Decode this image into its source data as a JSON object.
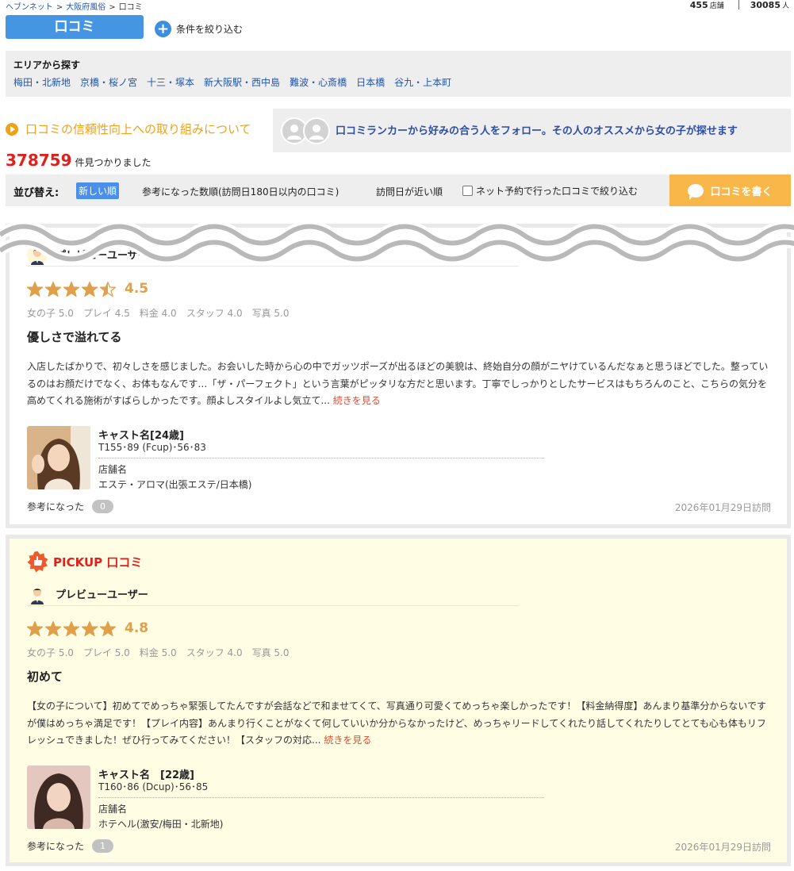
{
  "breadcrumb": [
    "ヘブンネット",
    "大阪府風俗",
    "口コミ"
  ],
  "breadcrumb_separator": ">",
  "stats": {
    "shops_count": "455",
    "shops_unit": "店舗",
    "people_count": "30085",
    "people_unit": "人"
  },
  "kuchikomi_button": "口コミ",
  "filter_link": "条件を絞り込む",
  "area": {
    "title": "エリアから探す",
    "links": [
      "梅田・北新地",
      "京橋・桜ノ宮",
      "十三・塚本",
      "新大阪駅・西中島",
      "難波・心斎橋",
      "日本橋",
      "谷九・上本町"
    ]
  },
  "trust_link": "口コミの信頼性向上への取り組みについて",
  "ranker_text": "口コミランカーから好みの合う人をフォロー。その人のオススメから女の子が探せます",
  "results": {
    "count": "378759",
    "suffix": "件見つかりました"
  },
  "sort": {
    "label": "並び替え:",
    "options": [
      "新しい順",
      "参考になった数順(訪問日180日以内の口コミ)",
      "訪問日が近い順"
    ],
    "net_filter": "ネット予約で行った口コミで絞り込む",
    "write_button": "口コミを書く"
  },
  "colors": {
    "accent_blue": "#4596e2",
    "link_blue": "#2255aa",
    "orange": "#f0a11a",
    "red": "#e1201b",
    "star": "#e0a04b",
    "pickup_bg": "#fffde3"
  },
  "reviews": [
    {
      "pickup": false,
      "user": "プレビューユーザー",
      "rating": 4.5,
      "rating_label": "4.5",
      "sub_ratings": "女の子 5.0　プレイ 4.5　料金 4.0　スタッフ 4.0　写真 5.0",
      "title": "優しさで溢れてる",
      "body": "入店したばかりで、初々しさを感じました。お会いした時から心の中でガッツポーズが出るほどの美貌は、終始自分の顔がニヤけているんだなぁと思うほどでした。整っているのはお顔だけでなく、お体もなんです…「ザ・パーフェクト」という言葉がピッタリな方だと思います。丁寧でしっかりとしたサービスはもちろんのこと、こちらの気分を高めてくれる施術がすばらしかったです。顔よしスタイルよし気立て... ",
      "more": "続きを見る",
      "cast_name": "キャスト名[24歳]",
      "cast_spec": "T155･89 (Fcup)･56･83",
      "shop_label": "店舗名",
      "shop_name": "エステ・アロマ(出張エステ/日本橋)",
      "helpful_label": "参考になった",
      "helpful_count": "0",
      "visit_date": "2026年01月29日訪問"
    },
    {
      "pickup": true,
      "pickup_label": "PICKUP 口コミ",
      "user": "プレビューユーザー",
      "rating": 4.8,
      "rating_label": "4.8",
      "sub_ratings": "女の子 5.0　プレイ 5.0　料金 5.0　スタッフ 4.0　写真 5.0",
      "title": "初めて",
      "body": "【女の子について】初めてでめっちゃ緊張してたんですが会話などで和ませてくて、写真通り可愛くてめっちゃ楽しかったです！【料金納得度】あんまり基準分からないですが僕はめっちゃ満足です！【プレイ内容】あんまり行くことがなくて何していいか分からなかったけど、めっちゃリードしてくれたり話してくれたりしてとても心も体もリフレッシュできました！ぜひ行ってみてください！【スタッフの対応... ",
      "more": "続きを見る",
      "cast_name": "キャスト名　[22歳]",
      "cast_spec": "T160･86 (Dcup)･56･85",
      "shop_label": "店舗名",
      "shop_name": "ホテヘル(激安/梅田・北新地)",
      "helpful_label": "参考になった",
      "helpful_count": "1",
      "visit_date": "2026年01月29日訪問"
    }
  ]
}
